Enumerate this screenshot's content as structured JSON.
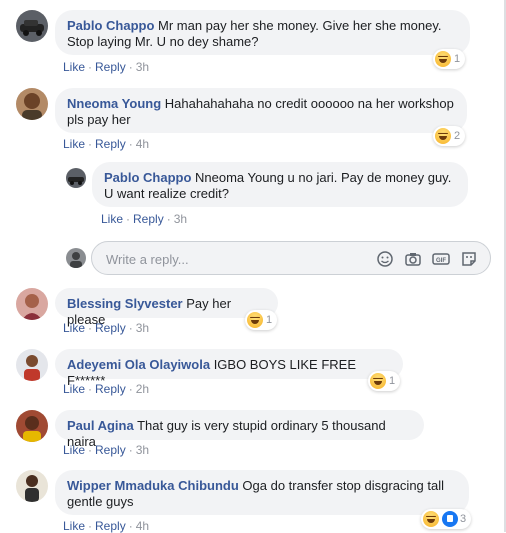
{
  "comments": [
    {
      "name": "Pablo Chappo",
      "text": "Mr man pay her she money. Give her she money. Stop laying Mr. U no dey shame?",
      "like": "Like",
      "reply": "Reply",
      "time": "3h",
      "reaction_count": "1"
    },
    {
      "name": "Nneoma Young",
      "text": "Hahahahahaha no credit oooooo na her workshop pls pay her",
      "like": "Like",
      "reply": "Reply",
      "time": "4h",
      "reaction_count": "2"
    },
    {
      "name": "Pablo Chappo",
      "text": "Nneoma Young u no jari. Pay de money guy. U want realize credit?",
      "like": "Like",
      "reply": "Reply",
      "time": "3h"
    },
    {
      "name": "Blessing Slyvester",
      "text": "Pay her please",
      "like": "Like",
      "reply": "Reply",
      "time": "3h",
      "reaction_count": "1"
    },
    {
      "name": "Adeyemi Ola Olayiwola",
      "text": "IGBO BOYS LIKE FREE F******",
      "like": "Like",
      "reply": "Reply",
      "time": "2h",
      "reaction_count": "1"
    },
    {
      "name": "Paul Agina",
      "text": "That guy is very stupid ordinary 5 thousand naira",
      "like": "Like",
      "reply": "Reply",
      "time": "3h"
    },
    {
      "name": "Wipper Mmaduka Chibundu",
      "text": "Oga do transfer stop disgracing tall gentle guys",
      "like": "Like",
      "reply": "Reply",
      "time": "4h",
      "reaction_count": "3"
    }
  ],
  "reply_box": {
    "placeholder": "Write a reply...",
    "icons": [
      "emoji-icon",
      "camera-icon",
      "gif-icon",
      "sticker-icon"
    ]
  },
  "colors": {
    "name": "#385898",
    "bubble": "#f2f3f5",
    "meta": "#90949c"
  }
}
